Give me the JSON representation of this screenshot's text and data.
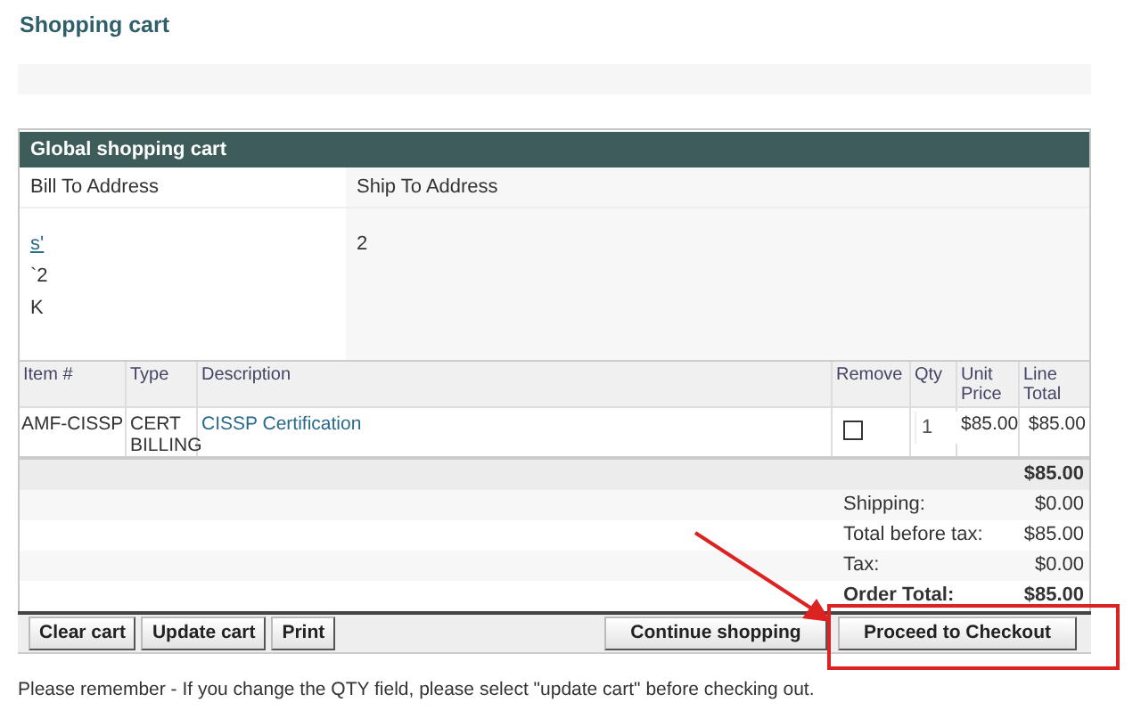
{
  "page": {
    "title": "Shopping cart"
  },
  "cart": {
    "header": "Global shopping cart",
    "address_headers": [
      "Bill To Address",
      "Ship To Address"
    ],
    "bill_lines": [
      {
        "text": "s'",
        "kind": "link"
      },
      {
        "text": "`2",
        "kind": "text"
      },
      {
        "text": "K",
        "kind": "text"
      }
    ],
    "ship_lines": [
      {
        "text": "2",
        "kind": "text"
      }
    ],
    "columns": [
      "Item #",
      "Type",
      "Description",
      "Remove",
      "Qty",
      "Unit Price",
      "Line Total"
    ],
    "rows": [
      {
        "item": "AMF-CISSP",
        "type": "CERT BILLING",
        "description": "CISSP Certification",
        "remove": false,
        "qty": "1",
        "unit_price": "$85.00",
        "line_total": "$85.00"
      }
    ],
    "subtotal": "$85.00",
    "totals": [
      {
        "label": "Shipping:",
        "value": "$0.00",
        "kind": "plain"
      },
      {
        "label": "Total before tax:",
        "value": "$85.00",
        "kind": "plain"
      },
      {
        "label": "Tax:",
        "value": "$0.00",
        "kind": "plain"
      },
      {
        "label": "Order Total:",
        "value": "$85.00",
        "kind": "grand"
      }
    ],
    "left_buttons": [
      {
        "label": "Clear cart",
        "highlighted": false
      },
      {
        "label": "Update cart",
        "highlighted": false
      },
      {
        "label": "Print",
        "highlighted": false
      }
    ],
    "right_buttons": [
      {
        "label": "Continue shopping",
        "highlighted": false
      },
      {
        "label": "Proceed to Checkout",
        "highlighted": true
      }
    ]
  },
  "note": "Please remember - If you change the QTY field, please select \"update cart\" before checking out."
}
